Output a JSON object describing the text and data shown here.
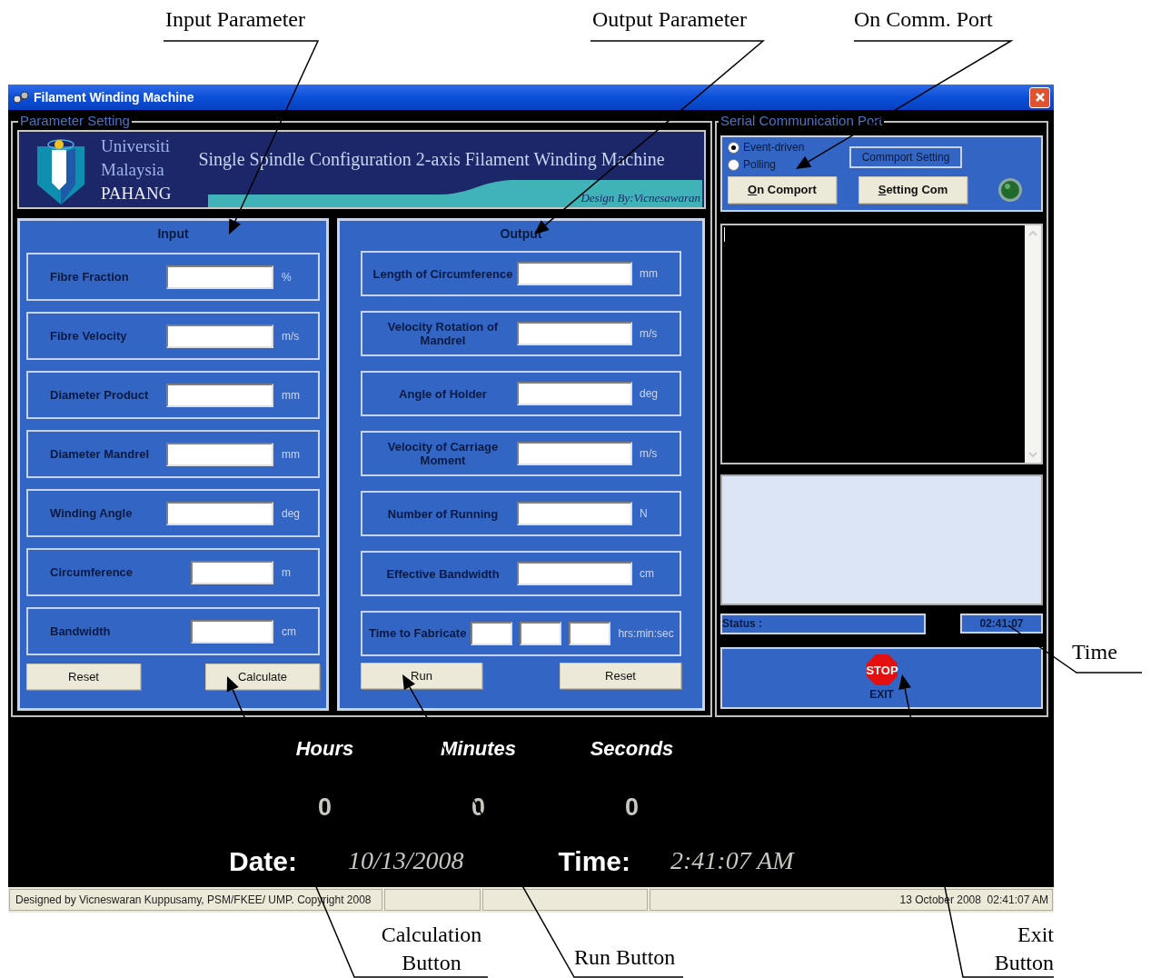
{
  "annotations": [
    {
      "label": "Input Parameter"
    },
    {
      "label": "Output Parameter"
    },
    {
      "label": "On Comm. Port"
    },
    {
      "label": "Time"
    },
    {
      "label": "Calculation Button"
    },
    {
      "label": "Run Button"
    },
    {
      "label": "Exit Button"
    }
  ],
  "window": {
    "title": "Filament Winding Machine"
  },
  "parameter_setting": {
    "legend": "Parameter Setting",
    "banner": {
      "university": [
        "Universiti",
        "Malaysia",
        "PAHANG"
      ],
      "title": "Single Spindle Configuration 2-axis Filament Winding Machine",
      "credit": "Design By:Vicnesawaran"
    },
    "input": {
      "title": "Input",
      "rows": [
        {
          "label": "Fibre Fraction",
          "unit": "%",
          "wide": true
        },
        {
          "label": "Fibre Velocity",
          "unit": "m/s",
          "wide": true
        },
        {
          "label": "Diameter Product",
          "unit": "mm",
          "wide": true
        },
        {
          "label": "Diameter Mandrel",
          "unit": "mm",
          "wide": true
        },
        {
          "label": "Winding Angle",
          "unit": "deg",
          "wide": true
        },
        {
          "label": "Circumference",
          "unit": "m",
          "wide": false
        },
        {
          "label": "Bandwidth",
          "unit": "cm",
          "wide": false
        }
      ],
      "buttons": [
        "Reset",
        "Calculate"
      ]
    },
    "output": {
      "title": "Output",
      "rows": [
        {
          "label": "Length of Circumference",
          "unit": "mm",
          "kind": "single"
        },
        {
          "label": "Velocity Rotation of Mandrel",
          "unit": "m/s",
          "kind": "single"
        },
        {
          "label": "Angle of Holder",
          "unit": "deg",
          "kind": "single"
        },
        {
          "label": "Velocity of Carriage Moment",
          "unit": "m/s",
          "kind": "single"
        },
        {
          "label": "Number of Running",
          "unit": "N",
          "kind": "single"
        },
        {
          "label": "Effective Bandwidth",
          "unit": "cm",
          "kind": "single"
        },
        {
          "label": "Time to Fabricate",
          "unit": "hrs:min:sec",
          "kind": "triple"
        }
      ],
      "buttons": [
        "Run",
        "Reset"
      ]
    }
  },
  "serial": {
    "legend": "Serial Communication Port",
    "modes": [
      {
        "label": "Event-driven",
        "selected": true
      },
      {
        "label": "Polling",
        "selected": false
      }
    ],
    "commport_setting": "Commport Setting",
    "buttons": [
      "On Comport",
      "Setting Com"
    ],
    "status_label": "Status :",
    "time": "02:41:07",
    "exit": {
      "sign": "STOP",
      "label": "EXIT"
    }
  },
  "clock": {
    "headers": [
      "Hours",
      "Minutes",
      "Seconds"
    ],
    "values": [
      "0",
      "0",
      "0"
    ],
    "date_label": "Date:",
    "date": "10/13/2008",
    "time_label": "Time:",
    "time": "2:41:07 AM"
  },
  "status_bar": {
    "left": "Designed by Vicneswaran Kuppusamy, PSM/FKEE/ UMP. Copyright 2008",
    "right": "13 October 2008  02:41:07 AM"
  }
}
